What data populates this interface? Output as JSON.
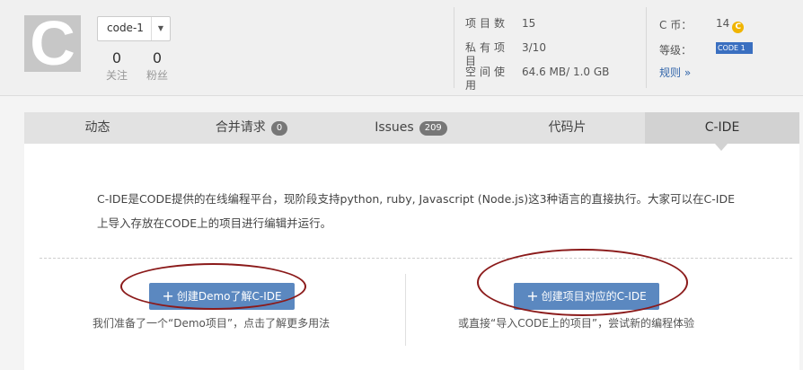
{
  "profile": {
    "avatar_letter": "C",
    "project_selector": "code-1",
    "following_count": "0",
    "following_label": "关注",
    "followers_count": "0",
    "followers_label": "粉丝"
  },
  "stats": {
    "projects_label": "项目数",
    "projects_value": "15",
    "private_label": "私有项目",
    "private_value": "3/10",
    "space_label": "空间使用",
    "space_value": "64.6 MB/ 1.0 GB"
  },
  "account": {
    "coin_label": "C 币：",
    "coin_value": "14",
    "coin_icon_glyph": "C",
    "level_label": "等级：",
    "level_badge": "CODE 1",
    "rules_link": "规则 »"
  },
  "tabs": [
    {
      "label": "动态"
    },
    {
      "label": "合并请求",
      "count": "0"
    },
    {
      "label": "Issues",
      "count": "209"
    },
    {
      "label": "代码片"
    },
    {
      "label": "C-IDE",
      "active": true
    }
  ],
  "main": {
    "desc_line1": "C-IDE是CODE提供的在线编程平台，现阶段支持python, ruby, Javascript (Node.js)这3种语言的直接执行。大家可以在C-IDE",
    "desc_line2": "上导入存放在CODE上的项目进行编辑并运行。",
    "demo_button": "创建Demo了解C-IDE",
    "demo_hint": "我们准备了一个“Demo项目”，点击了解更多用法",
    "project_button": "创建项目对应的C-IDE",
    "project_hint": "或直接“导入CODE上的项目”，尝试新的编程体验"
  },
  "colors": {
    "button_bg": "#5b88c0",
    "annotation_ellipse": "#8b1a1a",
    "link": "#3366aa",
    "coin": "#f0b400",
    "level_badge": "#3a6fc0"
  }
}
